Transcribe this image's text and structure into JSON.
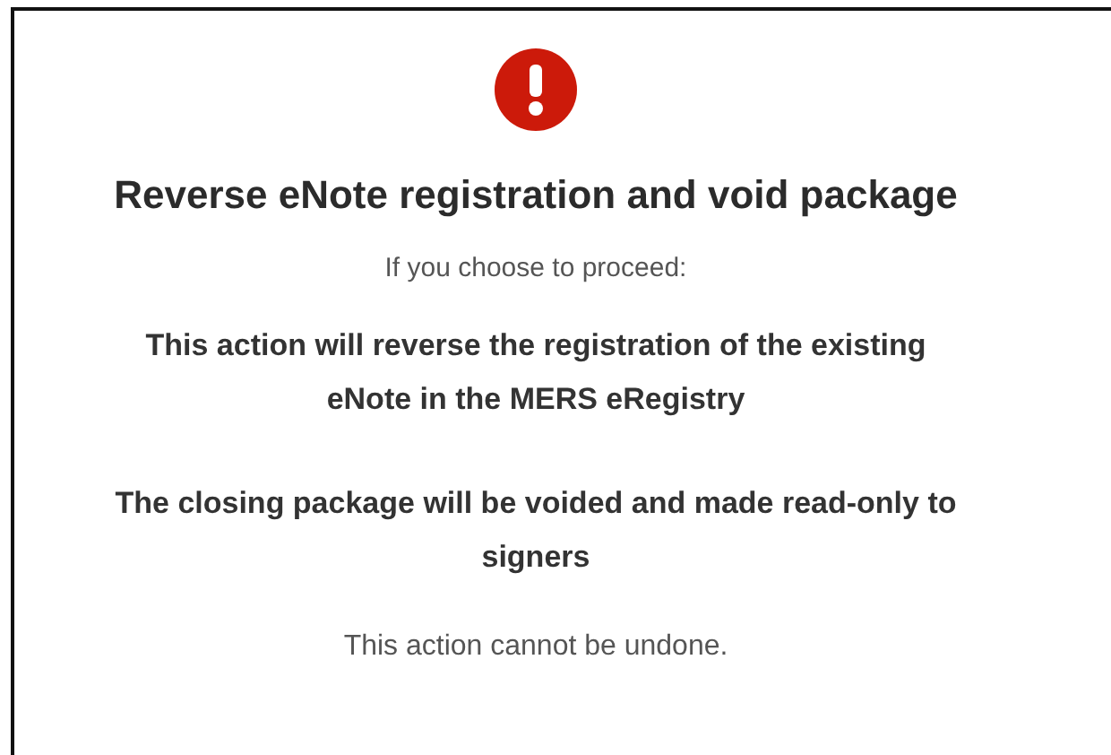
{
  "dialog": {
    "title": "Reverse eNote registration and void package",
    "intro": "If you choose to proceed:",
    "consequences": [
      "This action will reverse the registration of the existing eNote in the MERS eRegistry",
      "The closing package will be voided and made read-only to signers"
    ],
    "warning": "This action cannot be undone."
  }
}
